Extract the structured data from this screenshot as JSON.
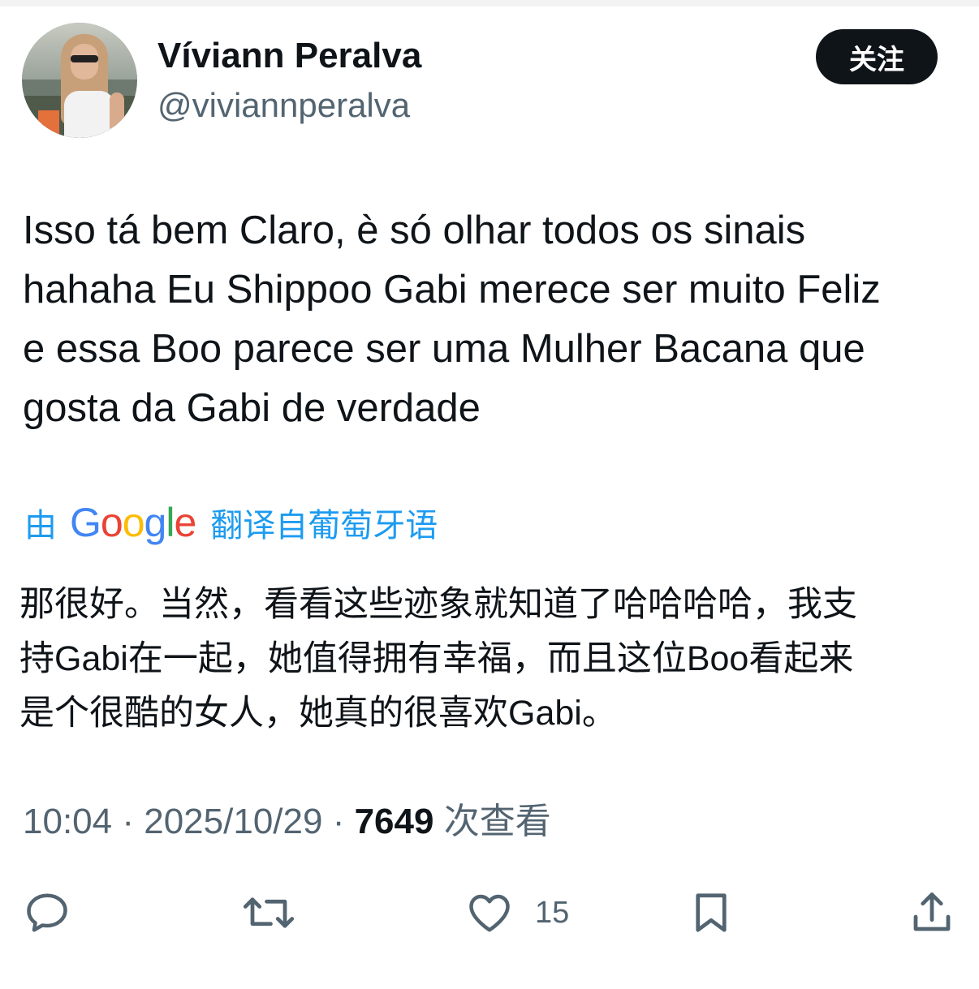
{
  "user": {
    "display_name": "Víviann Peralva",
    "handle": "@viviannperalva",
    "follow_label": "关注"
  },
  "tweet": {
    "text_lines": [
      "Isso tá bem Claro, è só olhar todos os sinais",
      "hahaha Eu Shippoo Gabi merece ser muito Feliz",
      "e essa Boo parece ser uma Mulher Bacana que",
      "gosta da Gabi de verdade"
    ],
    "translation": {
      "prefix": "由",
      "logo": "Google",
      "suffix": "翻译自葡萄牙语",
      "lines": [
        "那很好。当然，看看这些迹象就知道了哈哈哈哈，我支",
        "持Gabi在一起，她值得拥有幸福，而且这位Boo看起来",
        "是个很酷的女人，她真的很喜欢Gabi。"
      ]
    },
    "time": "10:04",
    "separator": "·",
    "date": "2025/10/29",
    "views": "7649",
    "views_label": "次查看"
  },
  "actions": {
    "reply_icon": "reply-icon",
    "retweet_icon": "retweet-icon",
    "like_icon": "heart-icon",
    "like_count": "15",
    "bookmark_icon": "bookmark-icon",
    "share_icon": "share-icon"
  },
  "colors": {
    "text": "#0f1419",
    "secondary": "#536471",
    "link": "#1d9bf0",
    "button_bg": "#0f1419"
  }
}
